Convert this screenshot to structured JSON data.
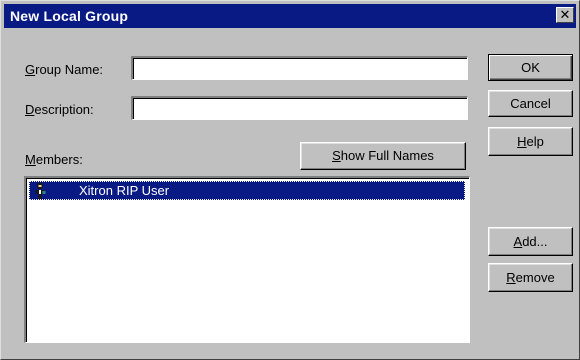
{
  "window": {
    "title": "New Local Group",
    "close_glyph": "✕"
  },
  "form": {
    "group_name_label_acc": "G",
    "group_name_label_rest": "roup Name:",
    "group_name_value": "",
    "description_label_acc": "D",
    "description_label_rest": "escription:",
    "description_value": "",
    "members_label_acc": "M",
    "members_label_rest": "embers:"
  },
  "buttons": {
    "ok": "OK",
    "cancel": "Cancel",
    "help_acc": "H",
    "help_rest": "elp",
    "show_full_names_acc": "S",
    "show_full_names_rest": "how Full Names",
    "add_acc": "A",
    "add_rest": "dd...",
    "remove_acc": "R",
    "remove_rest": "emove"
  },
  "members": {
    "items": [
      {
        "name": "Xitron RIP User",
        "icon": "user-icon",
        "selected": true
      }
    ]
  },
  "colors": {
    "titlebar": "#0a1a84",
    "selection": "#0a1a84",
    "face": "#c0c0c0"
  }
}
